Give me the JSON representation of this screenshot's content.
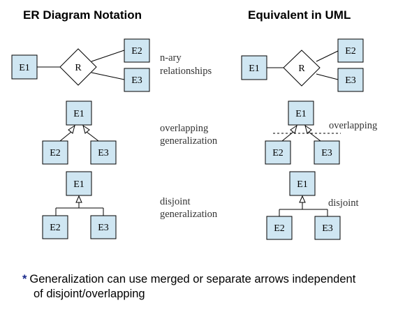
{
  "headings": {
    "left": "ER Diagram Notation",
    "right": "Equivalent in UML"
  },
  "entities": {
    "e1": "E1",
    "e2": "E2",
    "e3": "E3"
  },
  "relationship": "R",
  "notes": {
    "nary_line1": "n-ary",
    "nary_line2": "relationships",
    "overlap_line1": "overlapping",
    "overlap_line2": "generalization",
    "disjoint_line1": "disjoint",
    "disjoint_line2": "generalization"
  },
  "uml_labels": {
    "overlapping": "overlapping",
    "disjoint": "disjoint"
  },
  "footnote": {
    "marker": "*",
    "line1": "Generalization can use merged or separate arrows independent",
    "line2": "of disjoint/overlapping"
  },
  "colors": {
    "entity_fill": "#cfe6f2",
    "footnote_marker": "#1a2a8c"
  }
}
